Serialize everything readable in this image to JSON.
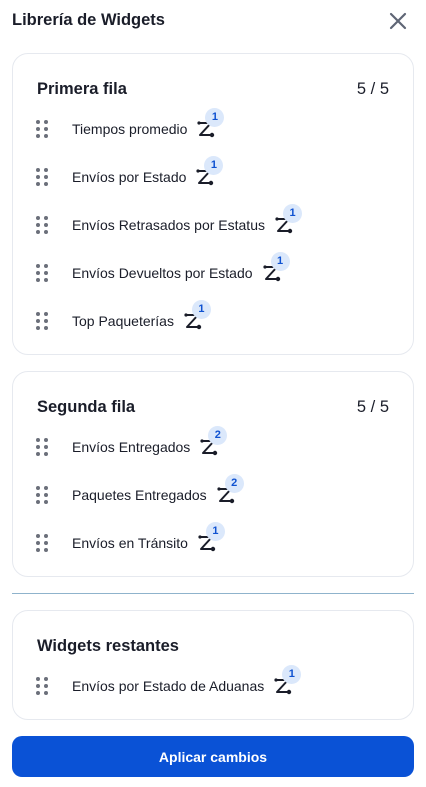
{
  "header": {
    "title": "Librería de Widgets"
  },
  "sections": [
    {
      "title": "Primera fila",
      "count": "5 / 5",
      "items": [
        {
          "label": "Tiempos promedio",
          "badge": "1"
        },
        {
          "label": "Envíos por Estado",
          "badge": "1"
        },
        {
          "label": "Envíos Retrasados por Estatus",
          "badge": "1"
        },
        {
          "label": "Envíos Devueltos por Estado",
          "badge": "1"
        },
        {
          "label": "Top Paqueterías",
          "badge": "1"
        }
      ]
    },
    {
      "title": "Segunda fila",
      "count": "5 / 5",
      "items": [
        {
          "label": "Envíos Entregados",
          "badge": "2"
        },
        {
          "label": "Paquetes Entregados",
          "badge": "2"
        },
        {
          "label": "Envíos en Tránsito",
          "badge": "1"
        }
      ]
    },
    {
      "title": "Widgets restantes",
      "items": [
        {
          "label": "Envíos por Estado de Aduanas",
          "badge": "1"
        }
      ]
    }
  ],
  "footer": {
    "apply_label": "Aplicar cambios"
  },
  "colors": {
    "primary": "#0a52d6",
    "badge_bg": "#dbe8fb",
    "badge_text": "#0f52d1",
    "card_border": "#e6e9ef"
  }
}
